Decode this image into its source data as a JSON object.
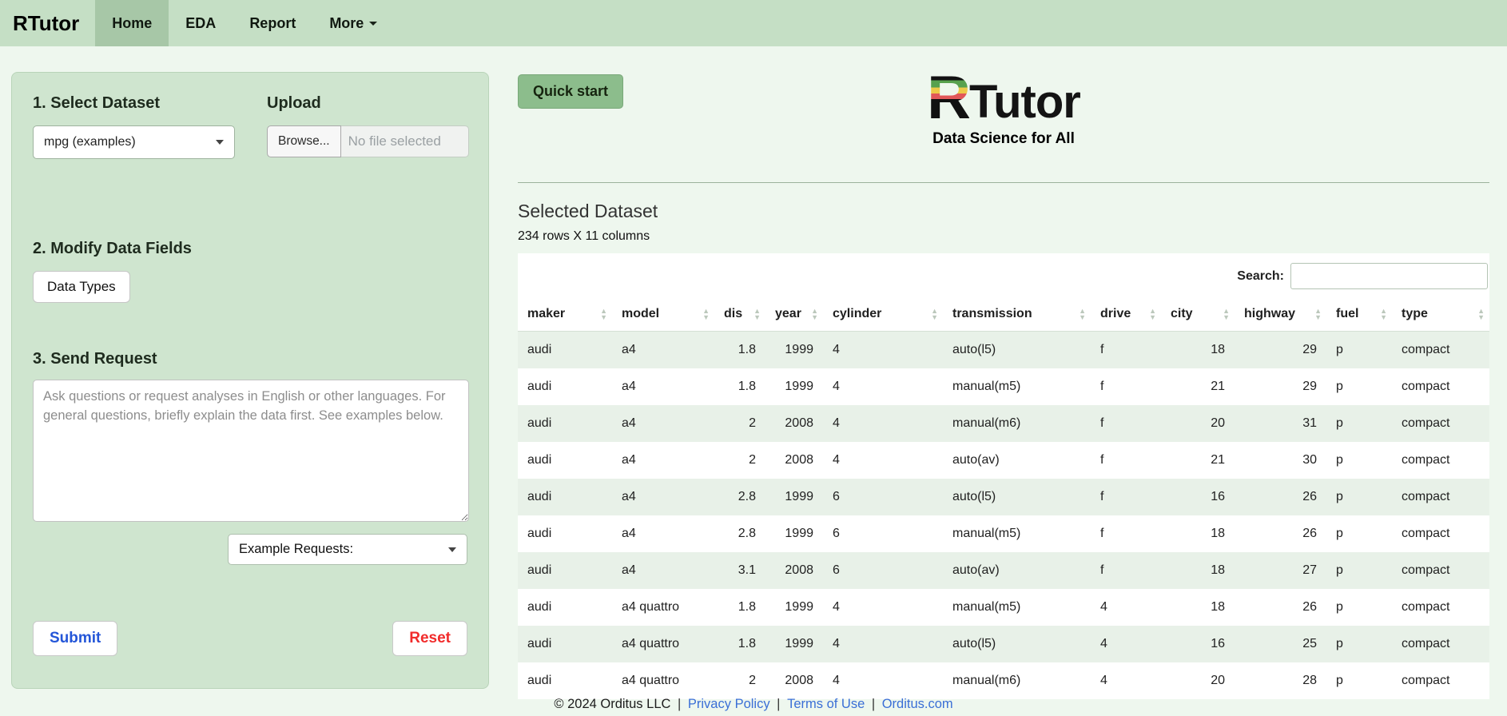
{
  "navbar": {
    "brand": "RTutor",
    "tabs": [
      {
        "label": "Home",
        "active": true,
        "dropdown": false
      },
      {
        "label": "EDA",
        "active": false,
        "dropdown": false
      },
      {
        "label": "Report",
        "active": false,
        "dropdown": false
      },
      {
        "label": "More",
        "active": false,
        "dropdown": true
      }
    ]
  },
  "sidebar": {
    "section1": {
      "title": "1. Select Dataset",
      "select_value": "mpg (examples)",
      "upload_title": "Upload",
      "browse_label": "Browse...",
      "file_placeholder": "No file selected"
    },
    "section2": {
      "title": "2. Modify Data Fields",
      "data_types_label": "Data Types"
    },
    "section3": {
      "title": "3. Send Request",
      "textarea_placeholder": "Ask questions or request analyses in English or other languages. For general questions, briefly explain the data first. See examples below.",
      "example_select_label": "Example Requests:"
    },
    "submit_label": "Submit",
    "reset_label": "Reset"
  },
  "main": {
    "quick_start_label": "Quick start",
    "logo": {
      "r": "R",
      "text": "Tutor",
      "tagline": "Data Science for All"
    },
    "selected_dataset_title": "Selected Dataset",
    "dataset_info": "234 rows X 11 columns",
    "search_label": "Search:",
    "search_value": "",
    "table": {
      "columns": [
        "maker",
        "model",
        "dis",
        "year",
        "cylinder",
        "transmission",
        "drive",
        "city",
        "highway",
        "fuel",
        "type"
      ],
      "rows": [
        [
          "audi",
          "a4",
          "1.8",
          "1999",
          "4",
          "auto(l5)",
          "f",
          "18",
          "29",
          "p",
          "compact"
        ],
        [
          "audi",
          "a4",
          "1.8",
          "1999",
          "4",
          "manual(m5)",
          "f",
          "21",
          "29",
          "p",
          "compact"
        ],
        [
          "audi",
          "a4",
          "2",
          "2008",
          "4",
          "manual(m6)",
          "f",
          "20",
          "31",
          "p",
          "compact"
        ],
        [
          "audi",
          "a4",
          "2",
          "2008",
          "4",
          "auto(av)",
          "f",
          "21",
          "30",
          "p",
          "compact"
        ],
        [
          "audi",
          "a4",
          "2.8",
          "1999",
          "6",
          "auto(l5)",
          "f",
          "16",
          "26",
          "p",
          "compact"
        ],
        [
          "audi",
          "a4",
          "2.8",
          "1999",
          "6",
          "manual(m5)",
          "f",
          "18",
          "26",
          "p",
          "compact"
        ],
        [
          "audi",
          "a4",
          "3.1",
          "2008",
          "6",
          "auto(av)",
          "f",
          "18",
          "27",
          "p",
          "compact"
        ],
        [
          "audi",
          "a4 quattro",
          "1.8",
          "1999",
          "4",
          "manual(m5)",
          "4",
          "18",
          "26",
          "p",
          "compact"
        ],
        [
          "audi",
          "a4 quattro",
          "1.8",
          "1999",
          "4",
          "auto(l5)",
          "4",
          "16",
          "25",
          "p",
          "compact"
        ],
        [
          "audi",
          "a4 quattro",
          "2",
          "2008",
          "4",
          "manual(m6)",
          "4",
          "20",
          "28",
          "p",
          "compact"
        ]
      ]
    }
  },
  "footer": {
    "copyright": "© 2024 Orditus LLC",
    "separator": "|",
    "links": [
      "Privacy Policy",
      "Terms of Use",
      "Orditus.com"
    ]
  },
  "colors": {
    "navbar_green": "#c5dfc5",
    "active_tab_green": "#a7c7a7",
    "panel_green": "#cfe5cf",
    "accent_green": "#8cbd8c",
    "stripe_green": "#e8f1e8",
    "link_blue": "#3a6fd6",
    "submit_blue": "#2456d8",
    "reset_red": "#f12b2b"
  }
}
